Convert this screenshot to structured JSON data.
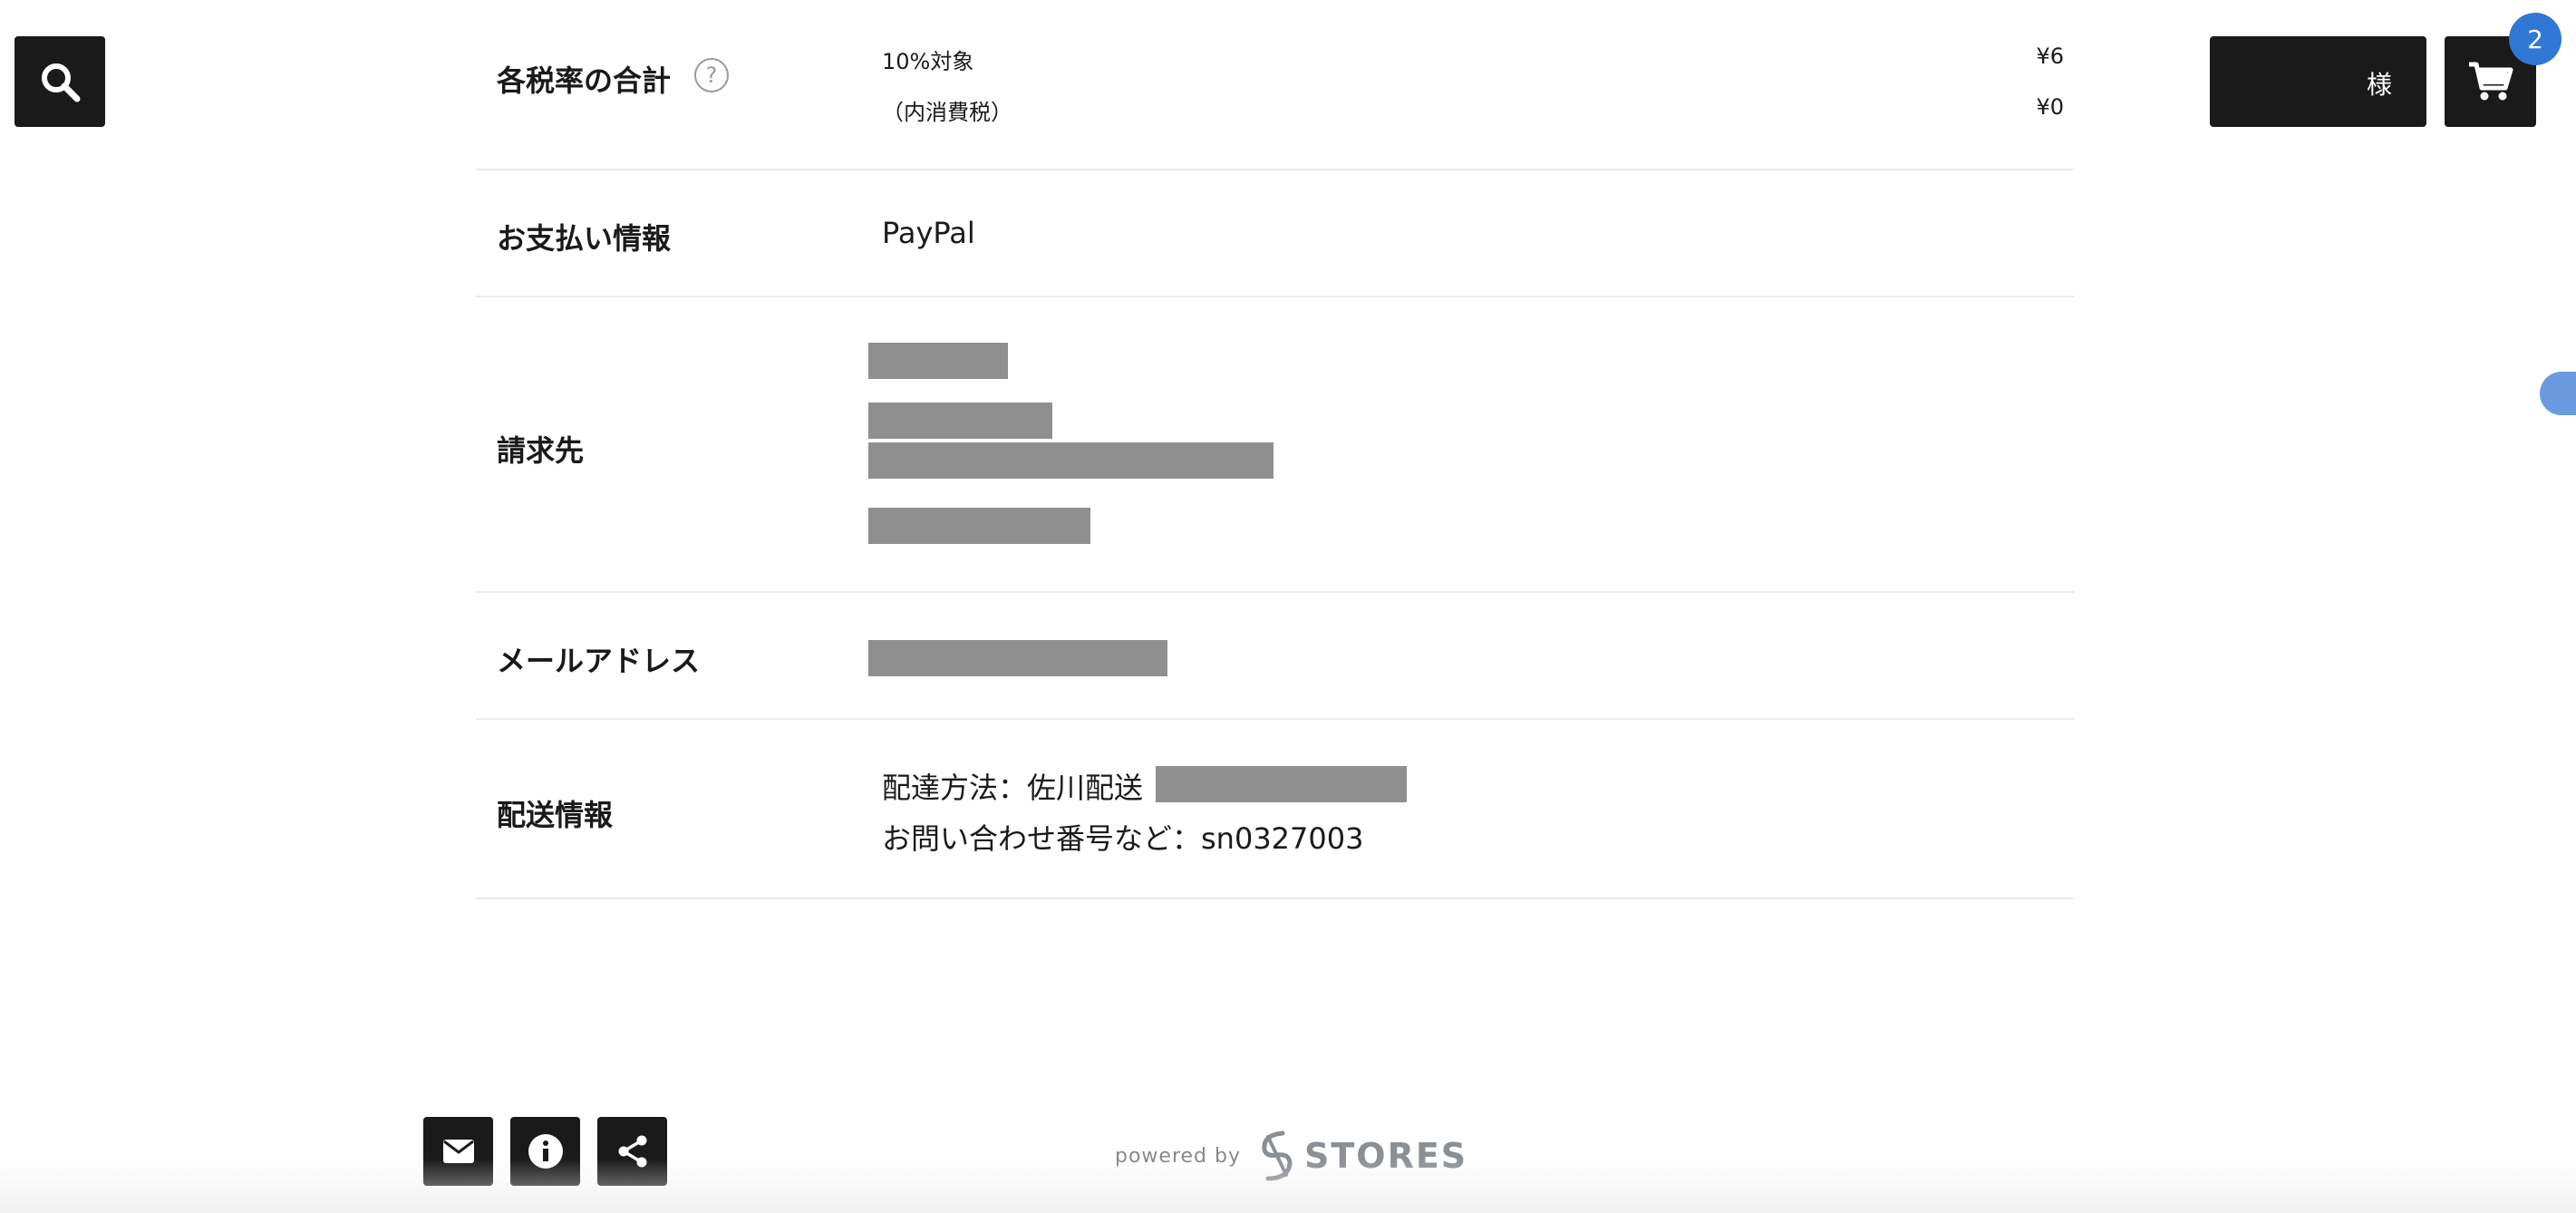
{
  "header": {
    "user_suffix": "様",
    "cart_badge": "2"
  },
  "tax_section": {
    "label": "各税率の合計",
    "help_glyph": "?",
    "line1_label": "10%対象",
    "line1_amount": "¥6",
    "line2_label": "（内消費税）",
    "line2_amount": "¥0"
  },
  "payment": {
    "label": "お支払い情報",
    "value": "PayPal"
  },
  "billing": {
    "label": "請求先"
  },
  "email": {
    "label": "メールアドレス"
  },
  "shipping": {
    "label": "配送情報",
    "method": "配達方法：佐川配送",
    "tracking": "お問い合わせ番号など：sn0327003"
  },
  "footer": {
    "powered_by": "powered by",
    "brand": "STORES"
  },
  "colors": {
    "dark": "#1a1a1a",
    "badge": "#2f78d6",
    "redaction": "#8f8f8f",
    "divider": "#ebebeb"
  }
}
